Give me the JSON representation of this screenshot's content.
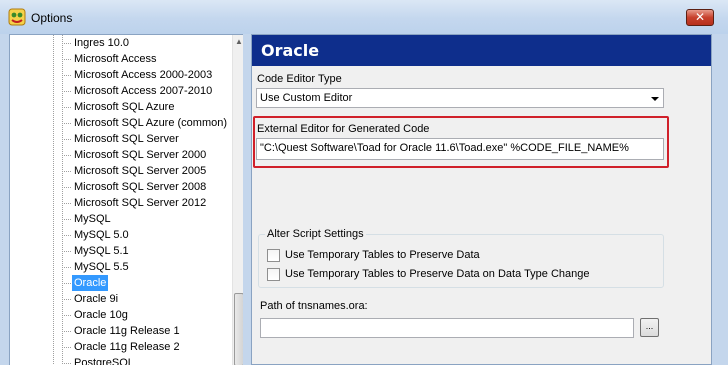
{
  "window": {
    "title": "Options",
    "close_label": "✕",
    "icon": "toad-app-icon"
  },
  "tree": {
    "items": [
      {
        "label": "Ingres 10.0",
        "selected": false
      },
      {
        "label": "Microsoft Access",
        "selected": false
      },
      {
        "label": "Microsoft Access 2000-2003",
        "selected": false
      },
      {
        "label": "Microsoft Access 2007-2010",
        "selected": false
      },
      {
        "label": "Microsoft SQL Azure",
        "selected": false
      },
      {
        "label": "Microsoft SQL Azure (common)",
        "selected": false
      },
      {
        "label": "Microsoft SQL Server",
        "selected": false
      },
      {
        "label": "Microsoft SQL Server 2000",
        "selected": false
      },
      {
        "label": "Microsoft SQL Server 2005",
        "selected": false
      },
      {
        "label": "Microsoft SQL Server 2008",
        "selected": false
      },
      {
        "label": "Microsoft SQL Server 2012",
        "selected": false
      },
      {
        "label": "MySQL",
        "selected": false
      },
      {
        "label": "MySQL 5.0",
        "selected": false
      },
      {
        "label": "MySQL 5.1",
        "selected": false
      },
      {
        "label": "MySQL 5.5",
        "selected": false
      },
      {
        "label": "Oracle",
        "selected": true
      },
      {
        "label": "Oracle 9i",
        "selected": false
      },
      {
        "label": "Oracle 10g",
        "selected": false
      },
      {
        "label": "Oracle 11g Release 1",
        "selected": false
      },
      {
        "label": "Oracle 11g Release 2",
        "selected": false
      },
      {
        "label": "PostgreSQL",
        "selected": false
      }
    ]
  },
  "panel": {
    "header": "Oracle",
    "code_editor_type_label": "Code Editor Type",
    "code_editor_type_value": "Use Custom Editor",
    "external_editor_label": "External Editor for Generated Code",
    "external_editor_value": "\"C:\\Quest Software\\Toad for Oracle 11.6\\Toad.exe\" %CODE_FILE_NAME%",
    "alter_script_title": "Alter Script Settings",
    "checkbox_temp_tables": "Use Temporary Tables to Preserve Data",
    "checkbox_temp_tables_type_change": "Use Temporary Tables to Preserve Data on Data Type Change",
    "tnsnames_label": "Path of tnsnames.ora:",
    "tnsnames_value": "",
    "browse_label": "..."
  },
  "colors": {
    "header_bg": "#0e2e8c",
    "selection": "#3399ff",
    "highlight_border": "#d0202a"
  }
}
